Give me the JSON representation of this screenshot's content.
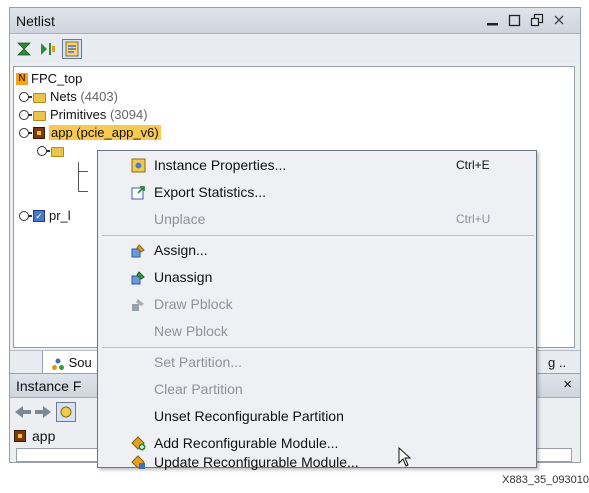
{
  "netlist": {
    "title": "Netlist",
    "window_controls": [
      "minimize-icon",
      "maximize-icon",
      "restore-icon",
      "close-icon"
    ],
    "toolbar_icons": [
      "collapse-all-icon",
      "expand-icon",
      "show-selection-icon"
    ],
    "tree": {
      "root": "FPC_top",
      "nets_label": "Nets",
      "nets_count": "(4403)",
      "primitives_label": "Primitives",
      "primitives_count": "(3094)",
      "app_label": "app (pcie_app_v6)",
      "pr_label": "pr_l"
    },
    "tabs": {
      "sources": "Sou",
      "right": "g .."
    }
  },
  "instance_window": {
    "title": "Instance F",
    "close_label": "×",
    "row_label": "app"
  },
  "context_menu": {
    "items": [
      {
        "label": "Instance Properties...",
        "accel": "Ctrl+E",
        "enabled": true,
        "icon": "properties-icon"
      },
      {
        "label": "Export Statistics...",
        "accel": "",
        "enabled": true,
        "icon": "export-icon"
      },
      {
        "label": "Unplace",
        "accel": "Ctrl+U",
        "enabled": false,
        "icon": ""
      },
      {
        "label": "Assign...",
        "accel": "",
        "enabled": true,
        "icon": "assign-icon"
      },
      {
        "label": "Unassign",
        "accel": "",
        "enabled": true,
        "icon": "unassign-icon"
      },
      {
        "label": "Draw Pblock",
        "accel": "",
        "enabled": false,
        "icon": "draw-pblock-icon"
      },
      {
        "label": "New Pblock",
        "accel": "",
        "enabled": false,
        "icon": ""
      },
      {
        "label": "Set Partition...",
        "accel": "",
        "enabled": false,
        "icon": ""
      },
      {
        "label": "Clear Partition",
        "accel": "",
        "enabled": false,
        "icon": ""
      },
      {
        "label": "Unset Reconfigurable Partition",
        "accel": "",
        "enabled": true,
        "icon": ""
      },
      {
        "label": "Add Reconfigurable Module...",
        "accel": "",
        "enabled": true,
        "icon": "add-module-icon"
      },
      {
        "label": "Update Reconfigurable Module...",
        "accel": "",
        "enabled": true,
        "icon": "update-module-icon"
      }
    ]
  },
  "caption": "X883_35_093010",
  "colors": {
    "highlight": "#f7c953",
    "menu_bg": "#eef0f4",
    "disabled_text": "#8e939a"
  }
}
